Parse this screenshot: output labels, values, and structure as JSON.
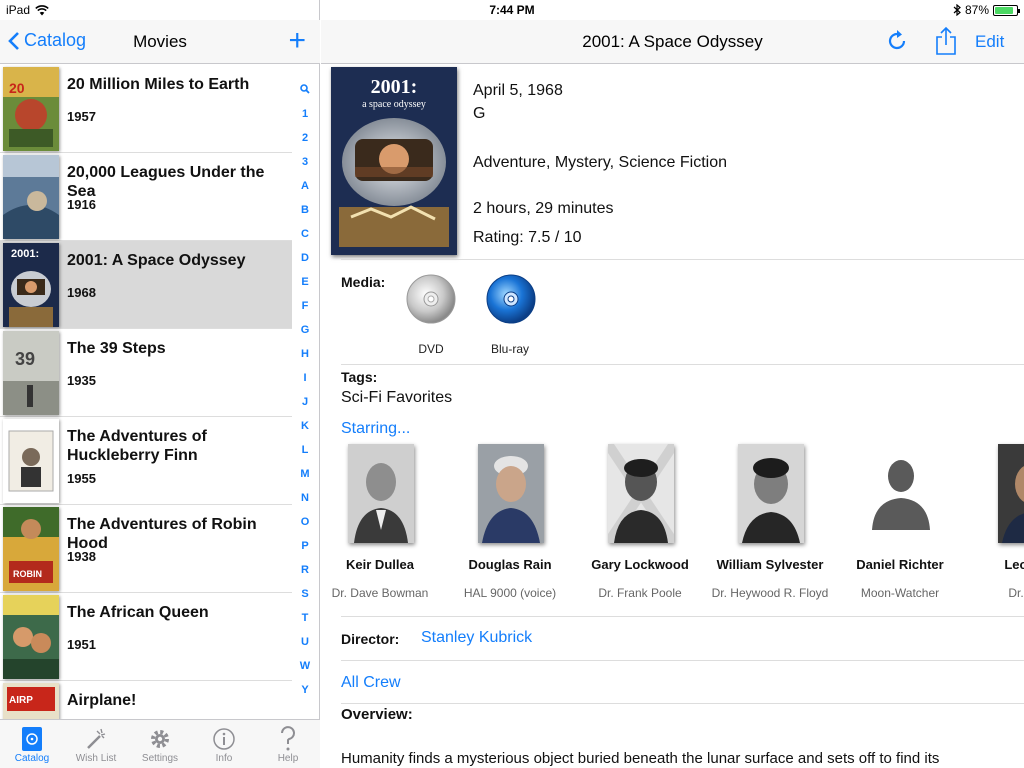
{
  "status": {
    "device": "iPad",
    "time": "7:44 PM",
    "battery": "87%",
    "battery_level": 0.87
  },
  "left_nav": {
    "back": "Catalog",
    "title": "Movies",
    "add": "+"
  },
  "movies": [
    {
      "title": "20 Million Miles to Earth",
      "year": "1957"
    },
    {
      "title": "20,000 Leagues Under the Sea",
      "year": "1916"
    },
    {
      "title": "2001: A Space Odyssey",
      "year": "1968"
    },
    {
      "title": "The 39 Steps",
      "year": "1935"
    },
    {
      "title": "The Adventures of Huckleberry Finn",
      "year": "1955"
    },
    {
      "title": "The Adventures of Robin Hood",
      "year": "1938"
    },
    {
      "title": "The African Queen",
      "year": "1951"
    },
    {
      "title": "Airplane!",
      "year": ""
    }
  ],
  "index_letters": [
    "1",
    "2",
    "3",
    "A",
    "B",
    "C",
    "D",
    "E",
    "F",
    "G",
    "H",
    "I",
    "J",
    "K",
    "L",
    "M",
    "N",
    "O",
    "P",
    "R",
    "S",
    "T",
    "U",
    "W",
    "Y"
  ],
  "tabs": [
    {
      "label": "Catalog",
      "icon": "catalog-icon"
    },
    {
      "label": "Wish List",
      "icon": "magic-wand-icon"
    },
    {
      "label": "Settings",
      "icon": "gear-icon"
    },
    {
      "label": "Info",
      "icon": "info-icon"
    },
    {
      "label": "Help",
      "icon": "question-icon"
    }
  ],
  "detail_nav": {
    "title": "2001: A Space Odyssey",
    "edit": "Edit"
  },
  "poster": {
    "line1": "2001:",
    "line2": "a space odyssey"
  },
  "detail": {
    "release_date": "April 5, 1968",
    "rating_mpaa": "G",
    "genres": "Adventure, Mystery, Science Fiction",
    "runtime": "2 hours, 29 minutes",
    "rating": "Rating: 7.5 / 10"
  },
  "media": {
    "label": "Media:",
    "items": [
      "DVD",
      "Blu-ray"
    ]
  },
  "tags": {
    "label": "Tags:",
    "value": "Sci-Fi Favorites"
  },
  "starring_link": "Starring...",
  "cast": [
    {
      "name": "Keir Dullea",
      "role": "Dr. Dave Bowman"
    },
    {
      "name": "Douglas Rain",
      "role": "HAL 9000 (voice)"
    },
    {
      "name": "Gary Lockwood",
      "role": "Dr. Frank Poole"
    },
    {
      "name": "William Sylvester",
      "role": "Dr. Heywood R. Floyd"
    },
    {
      "name": "Daniel Richter",
      "role": "Moon-Watcher"
    },
    {
      "name": "Leonard",
      "role": "Dr. Andr"
    }
  ],
  "director": {
    "label": "Director:",
    "name": "Stanley Kubrick"
  },
  "all_crew": "All Crew",
  "overview": {
    "label": "Overview:",
    "text": "Humanity finds a mysterious object buried beneath the lunar surface and sets off to find its"
  },
  "colors": {
    "accent": "#147efb",
    "selected_row": "#d9d9d9",
    "separator": "#dddddd"
  }
}
